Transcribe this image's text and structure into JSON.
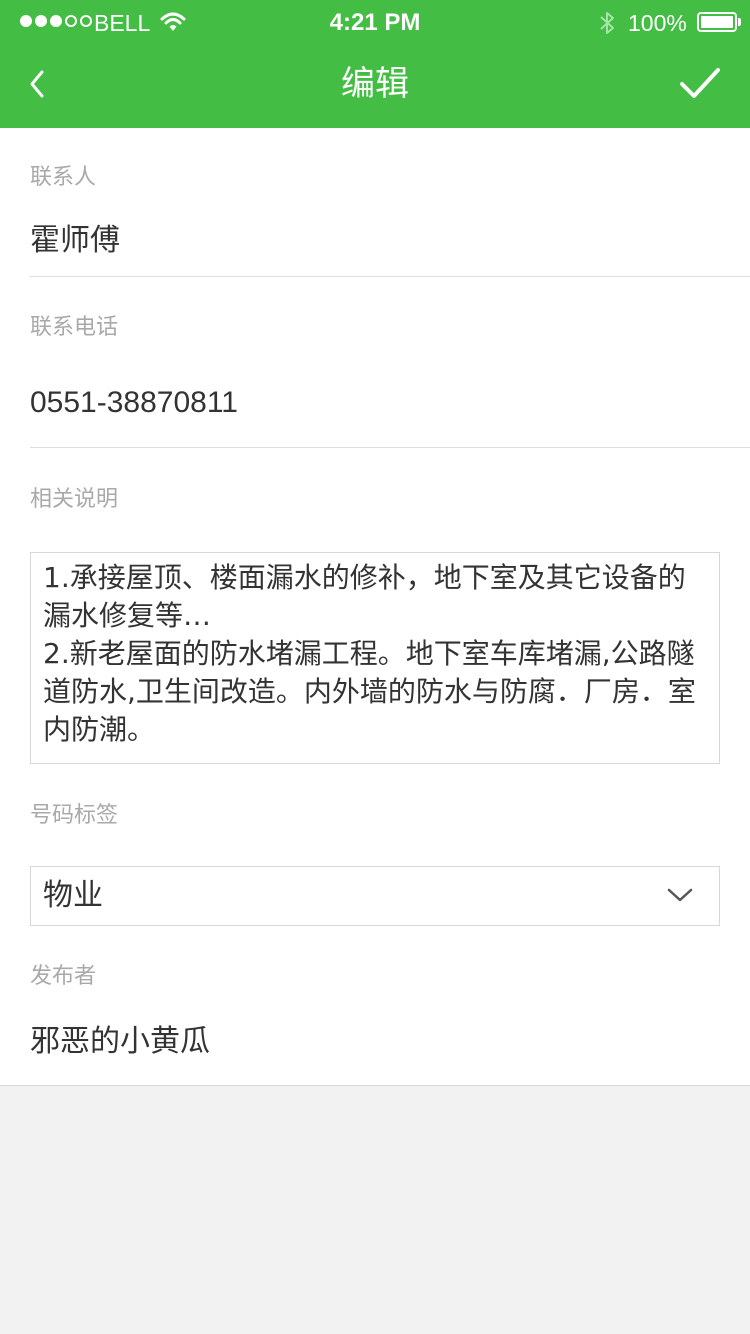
{
  "status_bar": {
    "carrier": "BELL",
    "time": "4:21 PM",
    "battery": "100%",
    "signal_bars_filled": 3,
    "signal_bars_total": 5,
    "icons": [
      "wifi-icon",
      "bluetooth-icon",
      "battery-icon"
    ]
  },
  "nav": {
    "title": "编辑",
    "back_icon": "chevron-left-icon",
    "confirm_icon": "checkmark-icon"
  },
  "form": {
    "contact": {
      "label": "联系人",
      "value": "霍师傅"
    },
    "phone": {
      "label": "联系电话",
      "value": "0551-38870811"
    },
    "description": {
      "label": "相关说明",
      "value": "1.承接屋顶、楼面漏水的修补，地下室及其它设备的漏水修复等…\n2.新老屋面的防水堵漏工程。地下室车库堵漏,公路隧道防水,卫生间改造。内外墙的防水与防腐．厂房．室内防潮。"
    },
    "tag": {
      "label": "号码标签",
      "value": "物业",
      "icon": "chevron-down-icon"
    },
    "publisher": {
      "label": "发布者",
      "value": "邪恶的小黄瓜"
    }
  },
  "colors": {
    "header": "#43bd43",
    "label": "#a9a9a9",
    "text": "#333333",
    "background": "#f2f2f2"
  }
}
